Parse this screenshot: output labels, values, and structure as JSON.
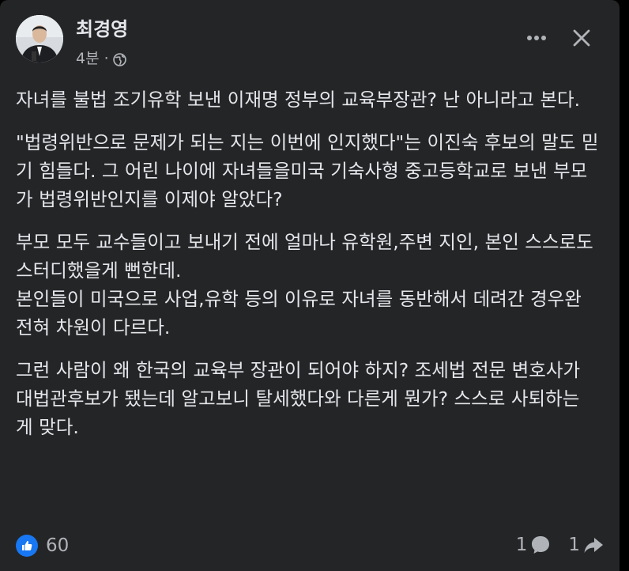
{
  "post": {
    "author_name": "최경영",
    "timestamp": "4분",
    "separator": "·",
    "audience_icon": "globe-icon",
    "more_icon": "more-horizontal-icon",
    "close_icon": "close-icon",
    "paragraphs": [
      "자녀를 불법 조기유학 보낸 이재명 정부의 교육부장관? 난 아니라고 본다.",
      "\"법령위반으로 문제가 되는 지는 이번에 인지했다\"는 이진숙 후보의 말도 믿기 힘들다. 그 어린 나이에 자녀들을미국 기숙사형 중고등학교로 보낸  부모가 법령위반인지를 이제야 알았다?",
      "부모 모두 교수들이고 보내기 전에 얼마나 유학원,주변 지인, 본인 스스로도 스터디했을게 뻔한데.\n본인들이 미국으로 사업,유학 등의 이유로 자녀를 동반해서 데려간 경우완 전혀 차원이 다르다.",
      "그런 사람이 왜 한국의 교육부 장관이 되어야 하지? 조세법 전문 변호사가 대법관후보가 됐는데 알고보니 탈세했다와 다른게 뭔가? 스스로 사퇴하는 게 맞다."
    ]
  },
  "footer": {
    "like_icon": "thumbs-up-icon",
    "like_count": "60",
    "comment_count": "1",
    "comment_icon": "comment-icon",
    "share_count": "1",
    "share_icon": "share-icon"
  },
  "colors": {
    "card_bg": "#242526",
    "text_primary": "#e4e6eb",
    "text_secondary": "#b0b3b8",
    "accent": "#1877f2"
  }
}
